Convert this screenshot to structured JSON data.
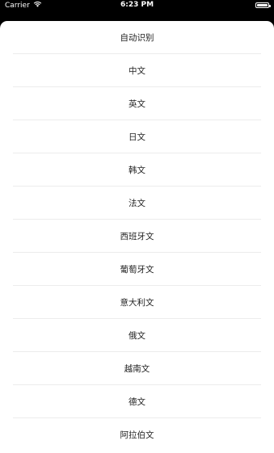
{
  "status_bar": {
    "carrier": "Carrier",
    "time": "6:23 PM",
    "wifi_icon": "wifi-icon",
    "battery_icon": "battery-icon"
  },
  "language_list": {
    "items": [
      {
        "label": "自动识别"
      },
      {
        "label": "中文"
      },
      {
        "label": "英文"
      },
      {
        "label": "日文"
      },
      {
        "label": "韩文"
      },
      {
        "label": "法文"
      },
      {
        "label": "西班牙文"
      },
      {
        "label": "葡萄牙文"
      },
      {
        "label": "意大利文"
      },
      {
        "label": "俄文"
      },
      {
        "label": "越南文"
      },
      {
        "label": "德文"
      },
      {
        "label": "阿拉伯文"
      }
    ]
  }
}
